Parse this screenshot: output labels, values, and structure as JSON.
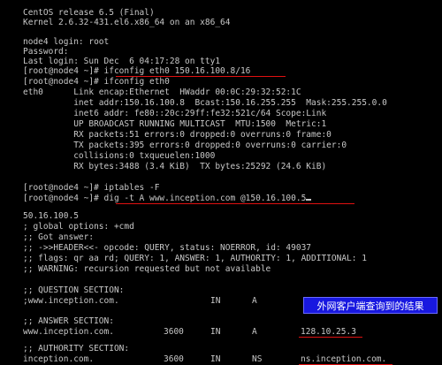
{
  "terminal": {
    "lines": [
      "CentOS release 6.5 (Final)",
      "Kernel 2.6.32-431.el6.x86_64 on an x86_64",
      "",
      "node4 login: root",
      "Password:",
      "Last login: Sun Dec  6 04:17:28 on tty1",
      "[root@node4 ~]# ifconfig eth0 150.16.100.8/16",
      "[root@node4 ~]# ifconfig eth0",
      "eth0      Link encap:Ethernet  HWaddr 00:0C:29:32:52:1C",
      "          inet addr:150.16.100.8  Bcast:150.16.255.255  Mask:255.255.0.0",
      "          inet6 addr: fe80::20c:29ff:fe32:521c/64 Scope:Link",
      "          UP BROADCAST RUNNING MULTICAST  MTU:1500  Metric:1",
      "          RX packets:51 errors:0 dropped:0 overruns:0 frame:0",
      "          TX packets:395 errors:0 dropped:0 overruns:0 carrier:0",
      "          collisions:0 txqueuelen:1000",
      "          RX bytes:3488 (3.4 KiB)  TX bytes:25292 (24.6 KiB)",
      "",
      "[root@node4 ~]# iptables -F",
      "[root@node4 ~]# dig -t A www.inception.com @150.16.100.5",
      "",
      "50.16.100.5",
      "; global options: +cmd",
      ";; Got answer:",
      ";; ->>HEADER<<- opcode: QUERY, status: NOERROR, id: 49037",
      ";; flags: qr aa rd; QUERY: 1, ANSWER: 1, AUTHORITY: 1, ADDITIONAL: 1",
      ";; WARNING: recursion requested but not available",
      "",
      ";; QUESTION SECTION:",
      ";www.inception.com.",
      "",
      ";; ANSWER SECTION:",
      "www.inception.com.",
      "",
      ";; AUTHORITY SECTION:",
      "inception.com."
    ],
    "question_row": {
      "class": "IN",
      "type": "A"
    },
    "answer_row": {
      "ttl": "3600",
      "class": "IN",
      "type": "A",
      "value": "128.10.25.3"
    },
    "authority_row": {
      "ttl": "3600",
      "class": "IN",
      "type": "NS",
      "value": "ns.inception.com."
    }
  },
  "annotation": {
    "callout_text": "外网客户端查询到的结果"
  },
  "colors": {
    "background": "#000000",
    "text": "#c8c8c8",
    "underline": "#e01010",
    "callout_bg": "#1818e0"
  }
}
